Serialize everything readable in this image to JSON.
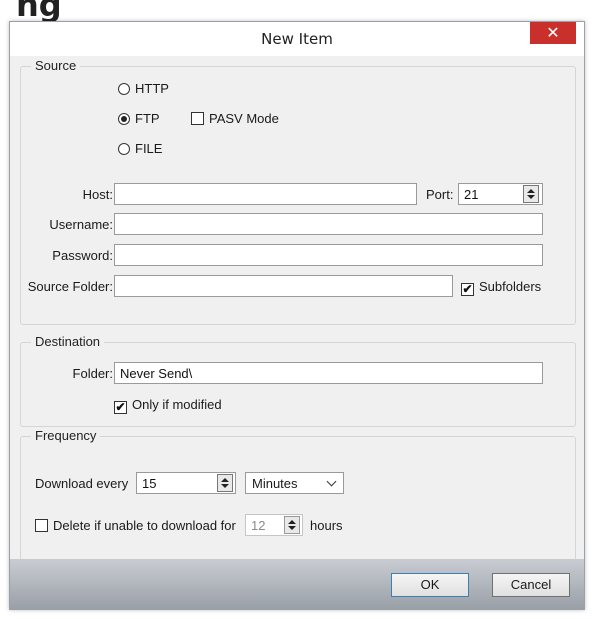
{
  "background_heading": "ng",
  "dialog": {
    "title": "New Item",
    "close_glyph": "✕"
  },
  "source": {
    "legend": "Source",
    "protocols": [
      {
        "label": "HTTP",
        "selected": false
      },
      {
        "label": "FTP",
        "selected": true
      },
      {
        "label": "FILE",
        "selected": false
      }
    ],
    "pasv_label": "PASV Mode",
    "pasv_checked": false,
    "host_label": "Host:",
    "host_value": "",
    "port_label": "Port:",
    "port_value": "21",
    "username_label": "Username:",
    "username_value": "",
    "password_label": "Password:",
    "password_value": "",
    "source_folder_label": "Source Folder:",
    "source_folder_value": "",
    "subfolders_label": "Subfolders",
    "subfolders_checked": true
  },
  "destination": {
    "legend": "Destination",
    "folder_label": "Folder:",
    "folder_value": "Never Send\\",
    "only_modified_label": "Only if modified",
    "only_modified_checked": true
  },
  "frequency": {
    "legend": "Frequency",
    "download_every_label": "Download every",
    "download_every_value": "15",
    "unit_value": "Minutes",
    "delete_label": "Delete if unable to download for",
    "delete_checked": false,
    "delete_value": "12",
    "hours_label": "hours"
  },
  "footer": {
    "ok_label": "OK",
    "cancel_label": "Cancel"
  },
  "colors": {
    "close_button": "#c9302c",
    "default_button_border": "#3c7fb1"
  },
  "icons": {
    "check": "✔"
  }
}
